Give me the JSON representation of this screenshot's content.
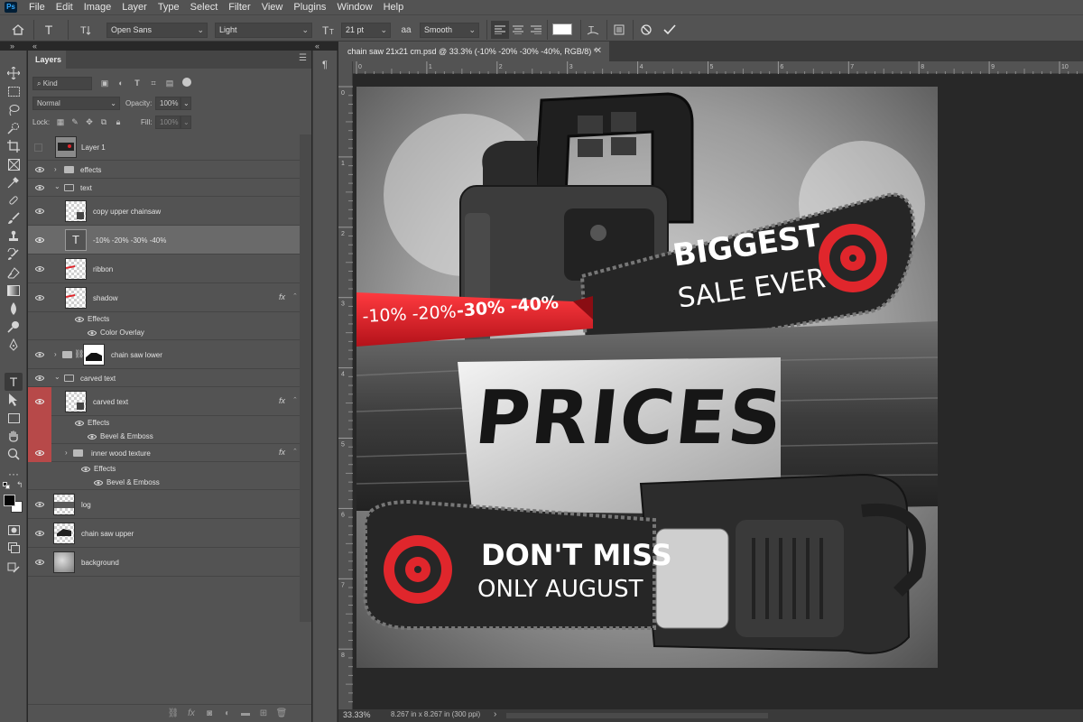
{
  "app": {
    "logo": "Ps"
  },
  "menu": [
    "File",
    "Edit",
    "Image",
    "Layer",
    "Type",
    "Select",
    "Filter",
    "View",
    "Plugins",
    "Window",
    "Help"
  ],
  "options_bar": {
    "font_family": "Open Sans",
    "font_style": "Light",
    "font_size": "21 pt",
    "antialias_icon": "aa",
    "antialias": "Smooth",
    "text_color": "#ffffff"
  },
  "layers_panel": {
    "tab_label": "Layers",
    "filter_placeholder": "Kind",
    "blend_mode": "Normal",
    "opacity_label": "Opacity:",
    "opacity_value": "100%",
    "lock_label": "Lock:",
    "fill_label": "Fill:",
    "fill_value": "100%",
    "layers": [
      {
        "name": "Layer 1",
        "kind": "layer",
        "visible": false
      },
      {
        "name": "effects",
        "kind": "group",
        "visible": true
      },
      {
        "name": "text",
        "kind": "group-open",
        "visible": true
      },
      {
        "name": "copy upper chainsaw",
        "kind": "layer",
        "visible": true
      },
      {
        "name": "-10% -20% -30% -40%",
        "kind": "type",
        "visible": true,
        "selected": true
      },
      {
        "name": "ribbon",
        "kind": "layer",
        "visible": true
      },
      {
        "name": "shadow",
        "kind": "layer",
        "visible": true,
        "fx": "fx"
      },
      {
        "name": "Effects",
        "kind": "effects-header"
      },
      {
        "name": "Color Overlay",
        "kind": "effect"
      },
      {
        "name": "chain saw lower",
        "kind": "group-masked",
        "visible": true
      },
      {
        "name": "carved text",
        "kind": "group-open",
        "visible": true
      },
      {
        "name": "carved text",
        "kind": "layer",
        "visible": true,
        "fx": "fx",
        "highlight": true
      },
      {
        "name": "Effects",
        "kind": "effects-header"
      },
      {
        "name": "Bevel & Emboss",
        "kind": "effect"
      },
      {
        "name": "inner wood texture",
        "kind": "group",
        "visible": true,
        "fx": "fx"
      },
      {
        "name": "Effects",
        "kind": "effects-header"
      },
      {
        "name": "Bevel & Emboss",
        "kind": "effect"
      },
      {
        "name": "log",
        "kind": "layer",
        "visible": true
      },
      {
        "name": "chain saw upper",
        "kind": "layer",
        "visible": true
      },
      {
        "name": "background",
        "kind": "layer",
        "visible": true
      }
    ]
  },
  "document": {
    "tab_title": "chain saw 21x21 cm.psd @ 33.3% (-10% -20% -30% -40%, RGB/8) *",
    "zoom": "33.33%",
    "doc_info": "8.267 in x 8.267 in (300 ppi)",
    "ruler_h": [
      "0",
      "1",
      "2",
      "3",
      "4",
      "5",
      "6",
      "7",
      "8",
      "9",
      "10"
    ],
    "ruler_v": [
      "0",
      "1",
      "2",
      "3",
      "4",
      "5",
      "6",
      "7",
      "8"
    ]
  },
  "artwork": {
    "headline_1": "BIGGEST",
    "headline_2": "SALE EVER",
    "ribbon_light": "-10% -20%",
    "ribbon_bold": "-30% -40%",
    "carved_word": "PRICES",
    "bottom_1": "DON'T MISS",
    "bottom_2": "ONLY AUGUST",
    "accent_color": "#e0262c"
  }
}
